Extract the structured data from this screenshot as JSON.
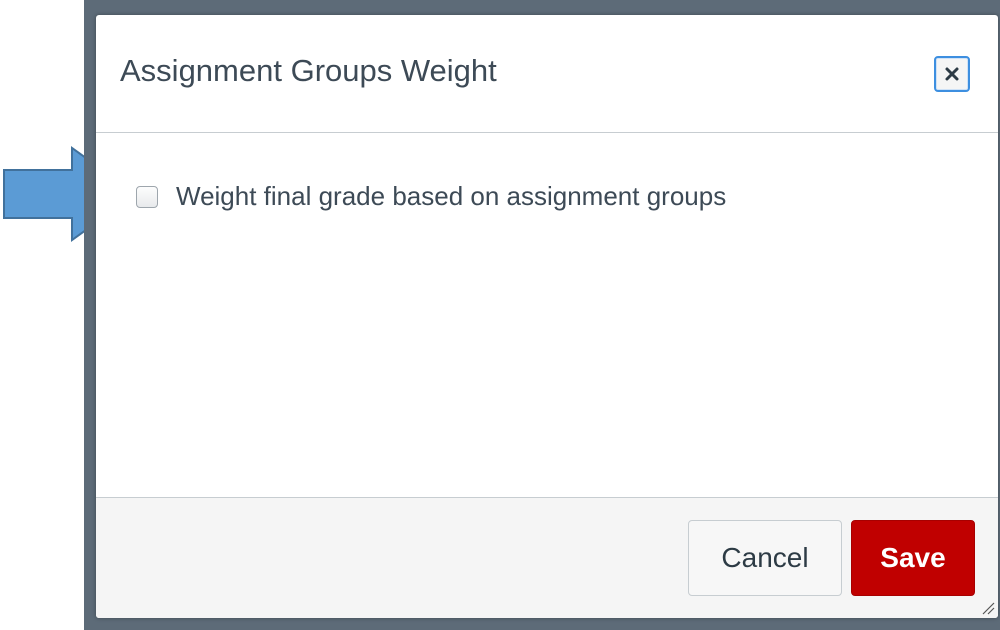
{
  "dialog": {
    "title": "Assignment Groups Weight",
    "close_icon": "close-icon"
  },
  "options": {
    "weight_checkbox_label": "Weight final grade based on assignment groups",
    "weight_checkbox_checked": false
  },
  "footer": {
    "cancel_label": "Cancel",
    "save_label": "Save"
  },
  "colors": {
    "annotation_arrow": "#5b9bd5",
    "save_button": "#c00000",
    "focus_ring": "#3d8fe0"
  },
  "icons": {
    "annotation": "right-arrow-icon",
    "resize": "resize-grip-icon"
  }
}
